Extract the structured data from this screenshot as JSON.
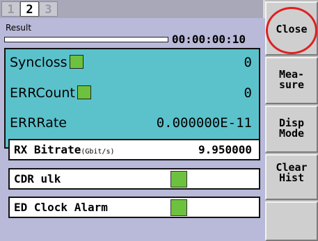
{
  "tabs": [
    {
      "label": "1",
      "state": "inactive"
    },
    {
      "label": "2",
      "state": "active"
    },
    {
      "label": "3",
      "state": "inactive"
    }
  ],
  "result": {
    "label": "Result",
    "timer": "00:00:00:10",
    "progress_fraction": 0
  },
  "measure_rows": [
    {
      "label": "Syncloss",
      "value": "0",
      "indicator_color": "#6cc23e"
    },
    {
      "label": "ERRCount",
      "value": "0",
      "indicator_color": "#6cc23e"
    },
    {
      "label": "ERRRate",
      "value": "0.000000E-11"
    }
  ],
  "status_rows": [
    {
      "label": "RX Bitrate",
      "unit": "(Gbit/s)",
      "value": "9.950000"
    },
    {
      "label": "CDR ulk",
      "indicator_color": "#6cc23e"
    },
    {
      "label": "ED Clock Alarm",
      "indicator_color": "#6cc23e"
    }
  ],
  "side_buttons": [
    {
      "line1": "Close",
      "line2": ""
    },
    {
      "line1": "Mea-",
      "line2": "sure"
    },
    {
      "line1": "Disp",
      "line2": "Mode"
    },
    {
      "line1": "Clear",
      "line2": "Hist"
    }
  ],
  "colors": {
    "panel_bg": "#b9b9d9",
    "teal_box": "#5bc2cc",
    "indicator_ok": "#6cc23e",
    "highlight": "#e02020"
  }
}
